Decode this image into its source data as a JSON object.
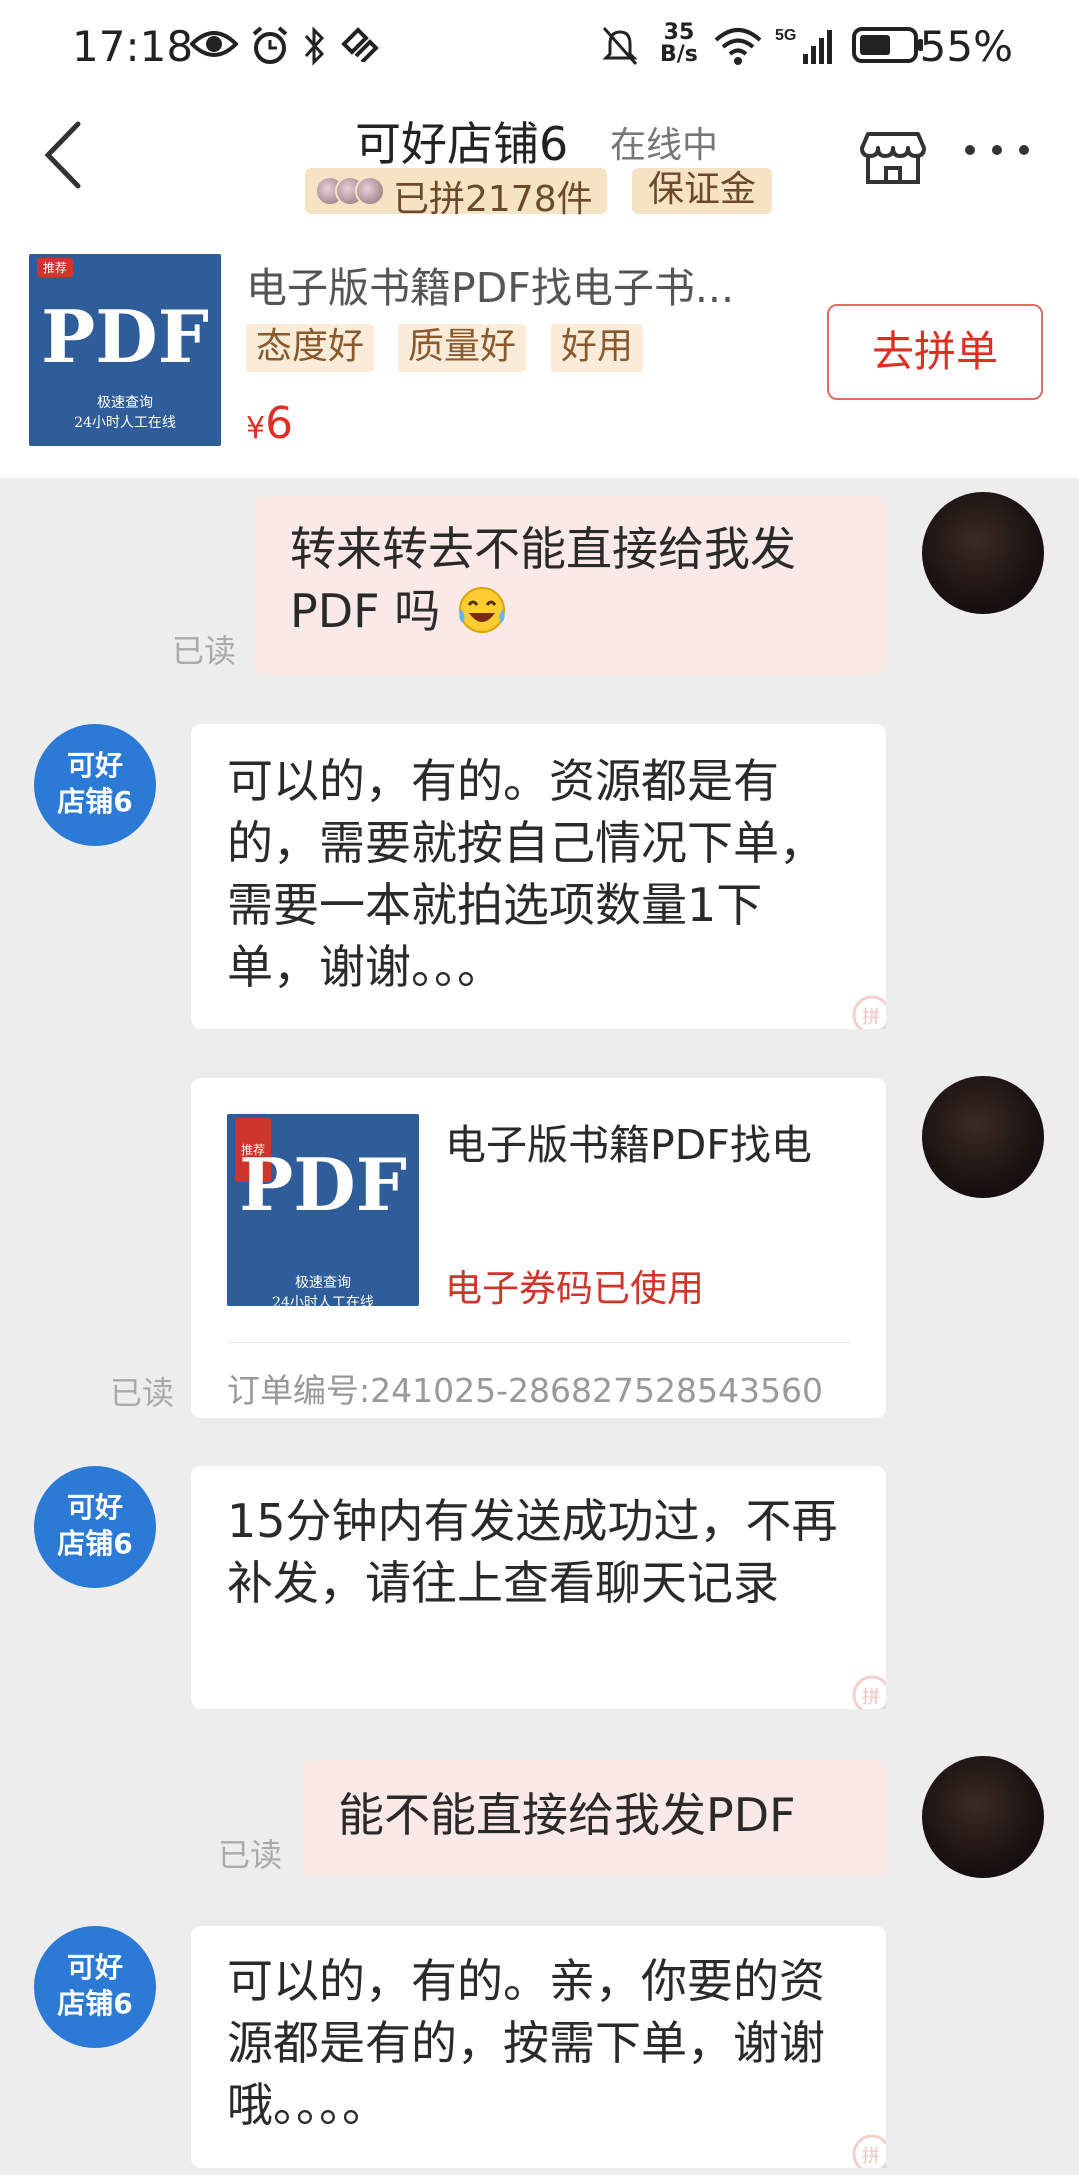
{
  "status_bar": {
    "time": "17:18",
    "net_speed_value": "35",
    "net_speed_unit": "B/s",
    "battery": "55%",
    "icons": [
      "eye-icon",
      "alarm-icon",
      "bluetooth-icon",
      "nfc-icon",
      "mute-icon",
      "wifi-icon",
      "signal-5g-icon",
      "battery-icon"
    ]
  },
  "header": {
    "shop_name": "可好店铺6",
    "online_status": "在线中",
    "group_badge": "已拼2178件",
    "deposit_badge": "保证金"
  },
  "product": {
    "thumb_tag": "推荐",
    "thumb_big": "PDF",
    "thumb_line1": "极速查询",
    "thumb_line2": "24小时人工在线",
    "title": "电子版书籍PDF找电子书...",
    "tags": [
      "态度好",
      "质量好",
      "好用"
    ],
    "price_currency": "¥",
    "price": "6",
    "button": "去拼单"
  },
  "chat": {
    "read_label": "已读",
    "shop_avatar_line1": "可好",
    "shop_avatar_line2": "店铺6",
    "m1_line1": "转来转去不能直接给我发",
    "m1_line2": "PDF 吗",
    "m2": "可以的，有的。资源都是有的，需要就按自己情况下单，需要一本就拍选项数量1下单，谢谢。。。",
    "order_title": "电子版书籍PDF找电",
    "order_status": "电子券码已使用",
    "order_no": "订单编号:241025-286827528543560",
    "m4": "15分钟内有发送成功过，不再补发，请往上查看聊天记录",
    "m5": "能不能直接给我发PDF",
    "m6": "可以的，有的。亲，你要的资源都是有的，按需下单，谢谢哦。。。。"
  },
  "colors": {
    "accent_red": "#e02e24",
    "shop_avatar_blue": "#2b7bd6",
    "my_bubble": "#fbe9e7",
    "badge_bg": "#f6e3c4"
  }
}
